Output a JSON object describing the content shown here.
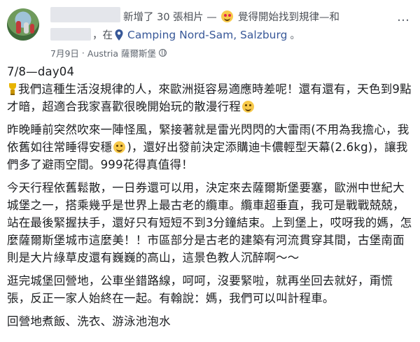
{
  "header": {
    "action_text": "新增了 30 張相片 —",
    "feeling_text": "覺得開始找到規律—和",
    "at_text": "，在",
    "place": "Camping Nord-Sam, Salzburg",
    "dot": "。",
    "date": "7月9日",
    "location": "Austria 薩爾斯堡",
    "more": "…"
  },
  "post": {
    "title": "7/8—day04",
    "para1": "我們這種生活沒規律的人，來歐洲挺容易適應時差呢！還有還有，天色到9點才暗，超適合我家喜歡很晚開始玩的散漫行程",
    "para2a": "昨晚睡前突然吹來一陣怪風，緊接著就是雷光閃閃的大雷雨(不用為我擔心，我依舊如往常睡得安穩",
    "para2b": ")，還好出發前決定添購迪卡儂輕型天幕(2.6kg)，讓我們多了避雨空間。999花得真值得！",
    "para3": "今天行程依舊鬆散，一日券還可以用，決定來去薩爾斯堡要塞，歐洲中世紀大城堡之一，搭乘幾乎是世界上最古老的纜車。纜車超垂直，我可是戰戰兢兢，站在最後緊握扶手，還好只有短短不到3分鐘結束。上到堡上，哎呀我的媽，怎麼薩爾斯堡城市這麼美！！市區部分是古老的建築有河流貫穿其間，古堡南面則是大片綠草皮還有巍巍的高山，這景色教人沉醉啊～～",
    "para4": "逛完城堡回營地，公車坐錯路線，呵呵，沒要緊啦，就再坐回去就好，甭慌張，反正一家人始終在一起。有翰說：媽，我們可以叫計程車。",
    "para5": "回營地煮飯、洗衣、游泳池泡水"
  },
  "colors": {
    "link": "#385898",
    "meta": "#606770",
    "text": "#1c1e21"
  }
}
